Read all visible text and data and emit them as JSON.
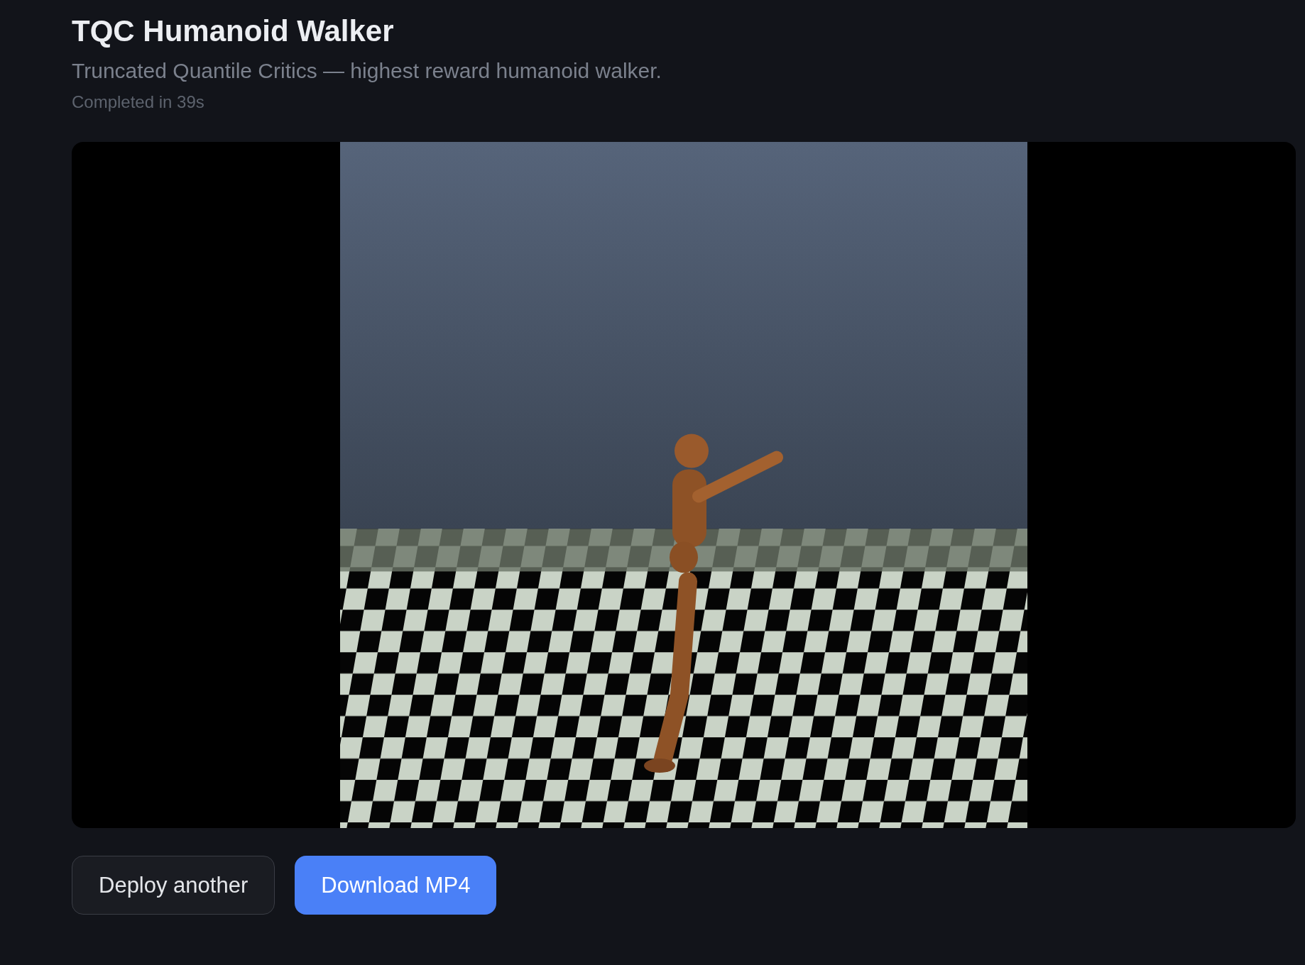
{
  "header": {
    "title": "TQC Humanoid Walker",
    "subtitle": "Truncated Quantile Critics — highest reward humanoid walker.",
    "status": "Completed in 39s"
  },
  "buttons": [
    {
      "label": "Deploy another",
      "kind": "secondary"
    },
    {
      "label": "Download MP4",
      "kind": "primary"
    }
  ]
}
